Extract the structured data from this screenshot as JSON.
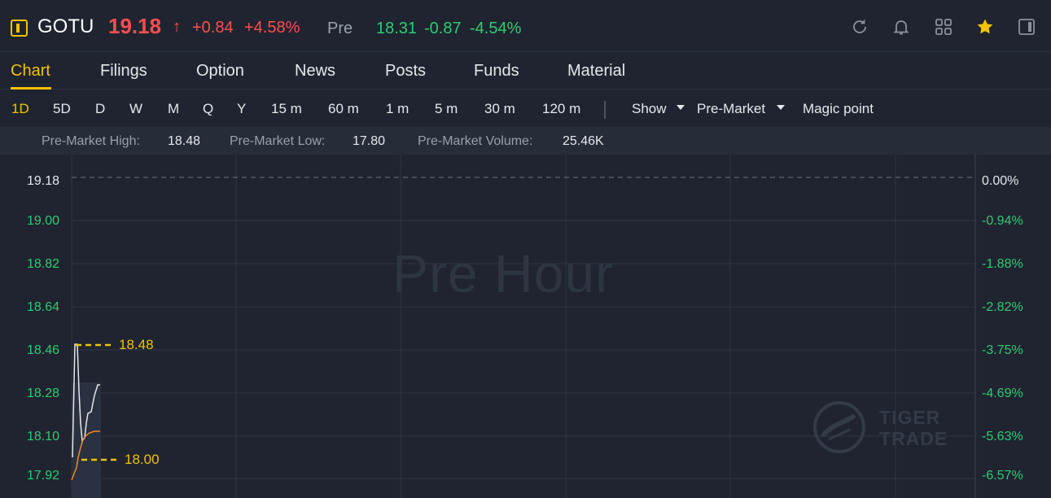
{
  "header": {
    "symbol": "GOTU",
    "price": "19.18",
    "arrow": "↑",
    "change": "+0.84",
    "change_pct": "+4.58%",
    "pre_label": "Pre",
    "pre_price": "18.31",
    "pre_change": "-0.87",
    "pre_change_pct": "-4.54%",
    "icons": [
      "refresh-icon",
      "bell-icon",
      "grid-icon",
      "star-icon",
      "panel-icon"
    ],
    "colors": {
      "up": "#ff4d4f",
      "down": "#2ecc71",
      "accent": "#f2c200"
    }
  },
  "tabs": [
    "Chart",
    "Filings",
    "Option",
    "News",
    "Posts",
    "Funds",
    "Material"
  ],
  "active_tab": "Chart",
  "periods": [
    "1D",
    "5D",
    "D",
    "W",
    "M",
    "Q",
    "Y",
    "15 m",
    "60 m",
    "1 m",
    "5 m",
    "30 m",
    "120 m"
  ],
  "active_period": "1D",
  "controls": {
    "show": "Show",
    "session": "Pre-Market",
    "magic": "Magic point"
  },
  "stats": {
    "high_label": "Pre-Market High:",
    "high": "18.48",
    "low_label": "Pre-Market Low:",
    "low": "17.80",
    "volume_label": "Pre-Market Volume:",
    "volume": "25.46K"
  },
  "chart": {
    "watermark": "Pre Hour",
    "brand_line1": "TIGER",
    "brand_line2": "TRADE",
    "prev_close": 19.18,
    "y_left": [
      "19.18",
      "19.00",
      "18.82",
      "18.64",
      "18.46",
      "18.28",
      "18.10",
      "17.92"
    ],
    "y_right": [
      "0.00%",
      "-0.94%",
      "-1.88%",
      "-2.82%",
      "-3.75%",
      "-4.69%",
      "-5.63%",
      "-6.57%"
    ],
    "high_marker": "18.48",
    "low_marker": "18.00"
  }
}
